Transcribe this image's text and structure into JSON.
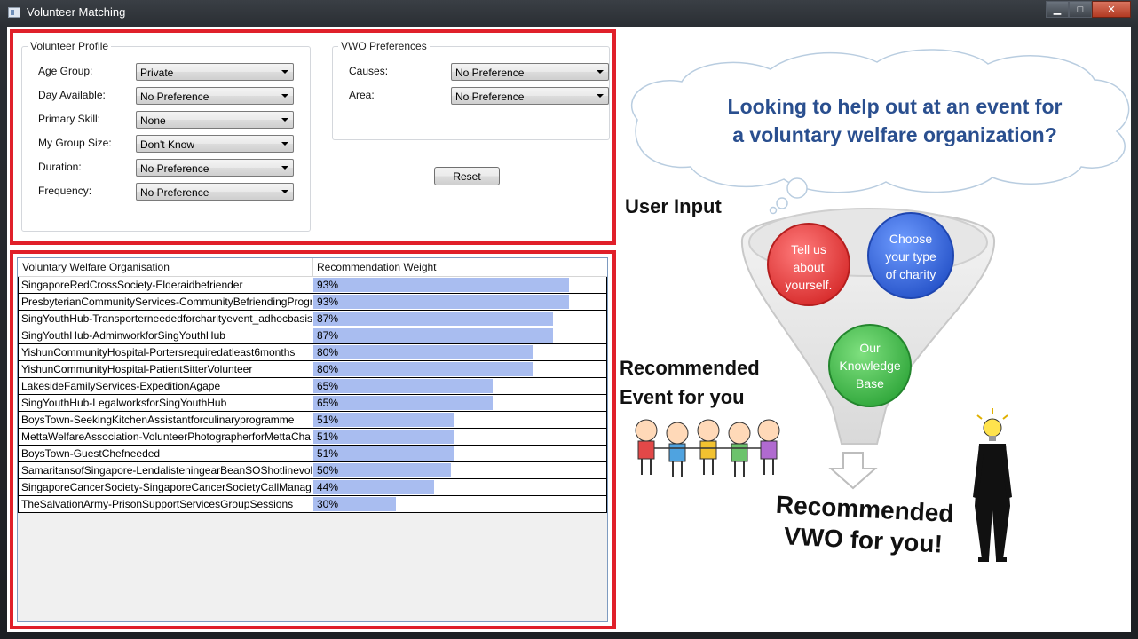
{
  "window": {
    "title": "Volunteer Matching",
    "min_glyph": "▁",
    "max_glyph": "□",
    "close_glyph": "✕"
  },
  "profile": {
    "legend": "Volunteer Profile",
    "fields": [
      {
        "label": "Age Group:",
        "value": "Private"
      },
      {
        "label": "Day Available:",
        "value": "No Preference"
      },
      {
        "label": "Primary Skill:",
        "value": "None"
      },
      {
        "label": "My Group Size:",
        "value": "Don't Know"
      },
      {
        "label": "Duration:",
        "value": "No Preference"
      },
      {
        "label": "Frequency:",
        "value": "No Preference"
      }
    ]
  },
  "vwo_prefs": {
    "legend": "VWO Preferences",
    "fields": [
      {
        "label": "Causes:",
        "value": "No Preference"
      },
      {
        "label": "Area:",
        "value": "No Preference"
      }
    ]
  },
  "reset_label": "Reset",
  "grid": {
    "columns": [
      "Voluntary Welfare Organisation",
      "Recommendation Weight"
    ],
    "rows": [
      {
        "name": "SingaporeRedCrossSociety-Elderaidbefriender",
        "weight": "93%",
        "pct": 93
      },
      {
        "name": "PresbyterianCommunityServices-CommunityBefriendingProgr",
        "weight": "93%",
        "pct": 93
      },
      {
        "name": "SingYouthHub-Transporterneededforcharityevent_adhocbasis",
        "weight": "87%",
        "pct": 87
      },
      {
        "name": "SingYouthHub-AdminworkforSingYouthHub",
        "weight": "87%",
        "pct": 87
      },
      {
        "name": "YishunCommunityHospital-Portersrequiredatleast6months",
        "weight": "80%",
        "pct": 80
      },
      {
        "name": "YishunCommunityHospital-PatientSitterVolunteer",
        "weight": "80%",
        "pct": 80
      },
      {
        "name": "LakesideFamilyServices-ExpeditionAgape",
        "weight": "65%",
        "pct": 65
      },
      {
        "name": "SingYouthHub-LegalworksforSingYouthHub",
        "weight": "65%",
        "pct": 65
      },
      {
        "name": "BoysTown-SeekingKitchenAssistantforculinaryprogramme",
        "weight": "51%",
        "pct": 51
      },
      {
        "name": "MettaWelfareAssociation-VolunteerPhotographerforMettaCha",
        "weight": "51%",
        "pct": 51
      },
      {
        "name": "BoysTown-GuestChefneeded",
        "weight": "51%",
        "pct": 51
      },
      {
        "name": "SamaritansofSingapore-LendalisteningearBeanSOShotlinevolu",
        "weight": "50%",
        "pct": 50
      },
      {
        "name": "SingaporeCancerSociety-SingaporeCancerSocietyCallManage",
        "weight": "44%",
        "pct": 44
      },
      {
        "name": "TheSalvationArmy-PrisonSupportServicesGroupSessions",
        "weight": "30%",
        "pct": 30
      }
    ]
  },
  "illustration": {
    "cloud_line1": "Looking to help out at an event for",
    "cloud_line2": "a voluntary welfare organization?",
    "user_input": "User Input",
    "recommended_event_line1": "Recommended",
    "recommended_event_line2": "Event for you",
    "recommended_vwo_line1": "Recommended",
    "recommended_vwo_line2": "VWO for you!",
    "bubble_red": [
      "Tell us",
      "about",
      "yourself."
    ],
    "bubble_blue": [
      "Choose",
      "your type",
      "of charity"
    ],
    "bubble_green": [
      "Our",
      "Knowledge",
      "Base"
    ]
  },
  "colors": {
    "panel_border": "#e0202a",
    "bar_fill": "#a9bdf0",
    "cloud_text": "#2a4f8f"
  }
}
